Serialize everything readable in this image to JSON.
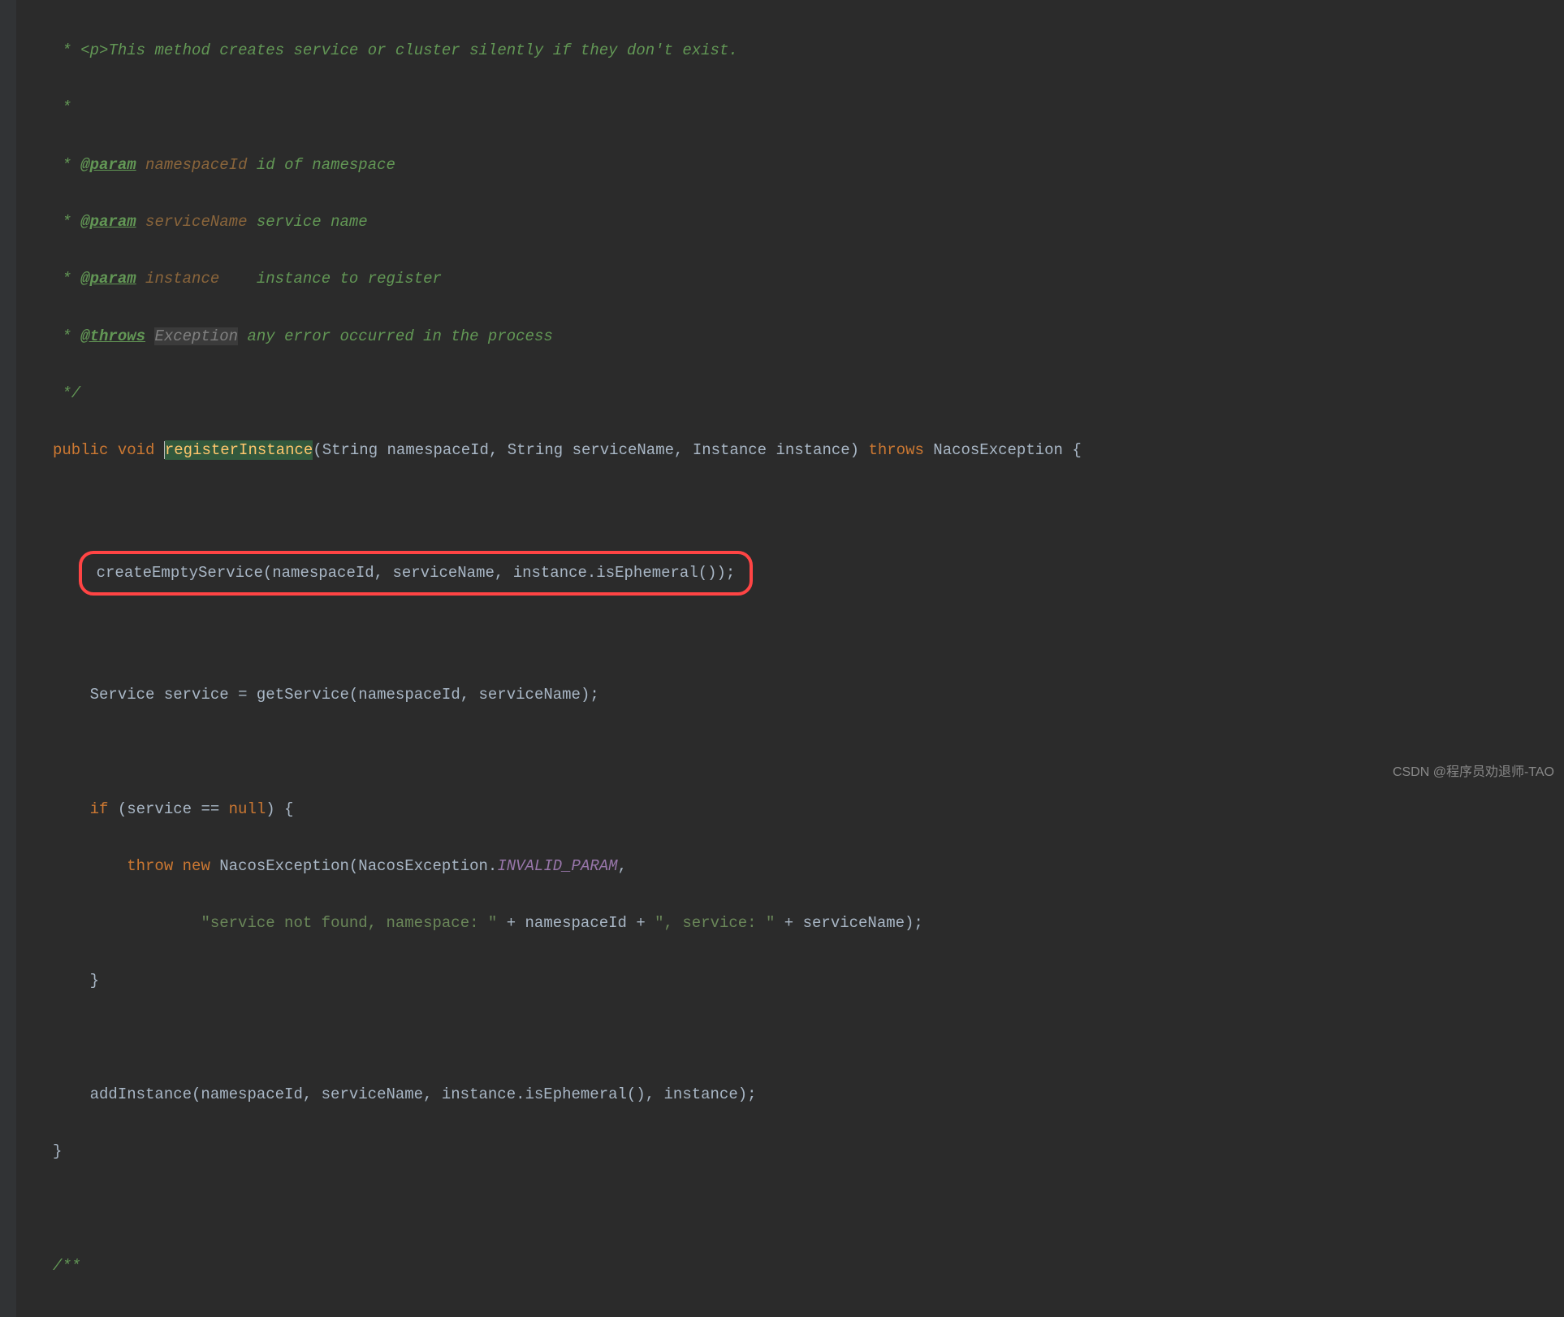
{
  "code": {
    "l1_star": " *",
    "l1_tag": "<p>",
    "l1_text": "This method creates service or cluster silently if they don't exist.",
    "l2_star": " *",
    "l3_star": " *",
    "l3_tag": "@param",
    "l3_name": "namespaceId",
    "l3_desc": "id of namespace",
    "l4_star": " *",
    "l4_tag": "@param",
    "l4_name": "serviceName",
    "l4_desc": "service name",
    "l5_star": " *",
    "l5_tag": "@param",
    "l5_name": "instance",
    "l5_desc": "   instance to register",
    "l6_star": " *",
    "l6_tag": "@throws",
    "l6_exc": "Exception",
    "l6_desc": "any error occurred in the process",
    "l7_star": " */",
    "l8_public": "public",
    "l8_void": "void",
    "l8_method": "registerInstance",
    "l8_p1type": "String",
    "l8_p1name": "namespaceId",
    "l8_p2type": "String",
    "l8_p2name": "serviceName",
    "l8_p3type": "Instance",
    "l8_p3name": "instance",
    "l8_throws": "throws",
    "l8_exc": "NacosException",
    "l10_call": "createEmptyService(namespaceId, serviceName, instance.isEphemeral());",
    "l12_type": "Service",
    "l12_var": "service",
    "l12_eq": "=",
    "l12_call": "getService(namespaceId, serviceName);",
    "l14_if": "if",
    "l14_cond_open": "(service ==",
    "l14_null": "null",
    "l14_cond_close": ") {",
    "l15_throw": "throw",
    "l15_new": "new",
    "l15_exc": "NacosException(NacosException.",
    "l15_field": "INVALID_PARAM",
    "l15_comma": ",",
    "l16_str1": "\"service not found, namespace: \"",
    "l16_plus1": "+",
    "l16_var1": "namespaceId",
    "l16_plus2": "+",
    "l16_str2": "\", service: \"",
    "l16_plus3": "+",
    "l16_var2": "serviceName);",
    "l17_close": "}",
    "l19_call": "addInstance(namespaceId, serviceName, instance.isEphemeral(), instance);",
    "l20_close": "}",
    "l22_comment": "/**"
  },
  "watermark": "CSDN @程序员劝退师-TAO"
}
